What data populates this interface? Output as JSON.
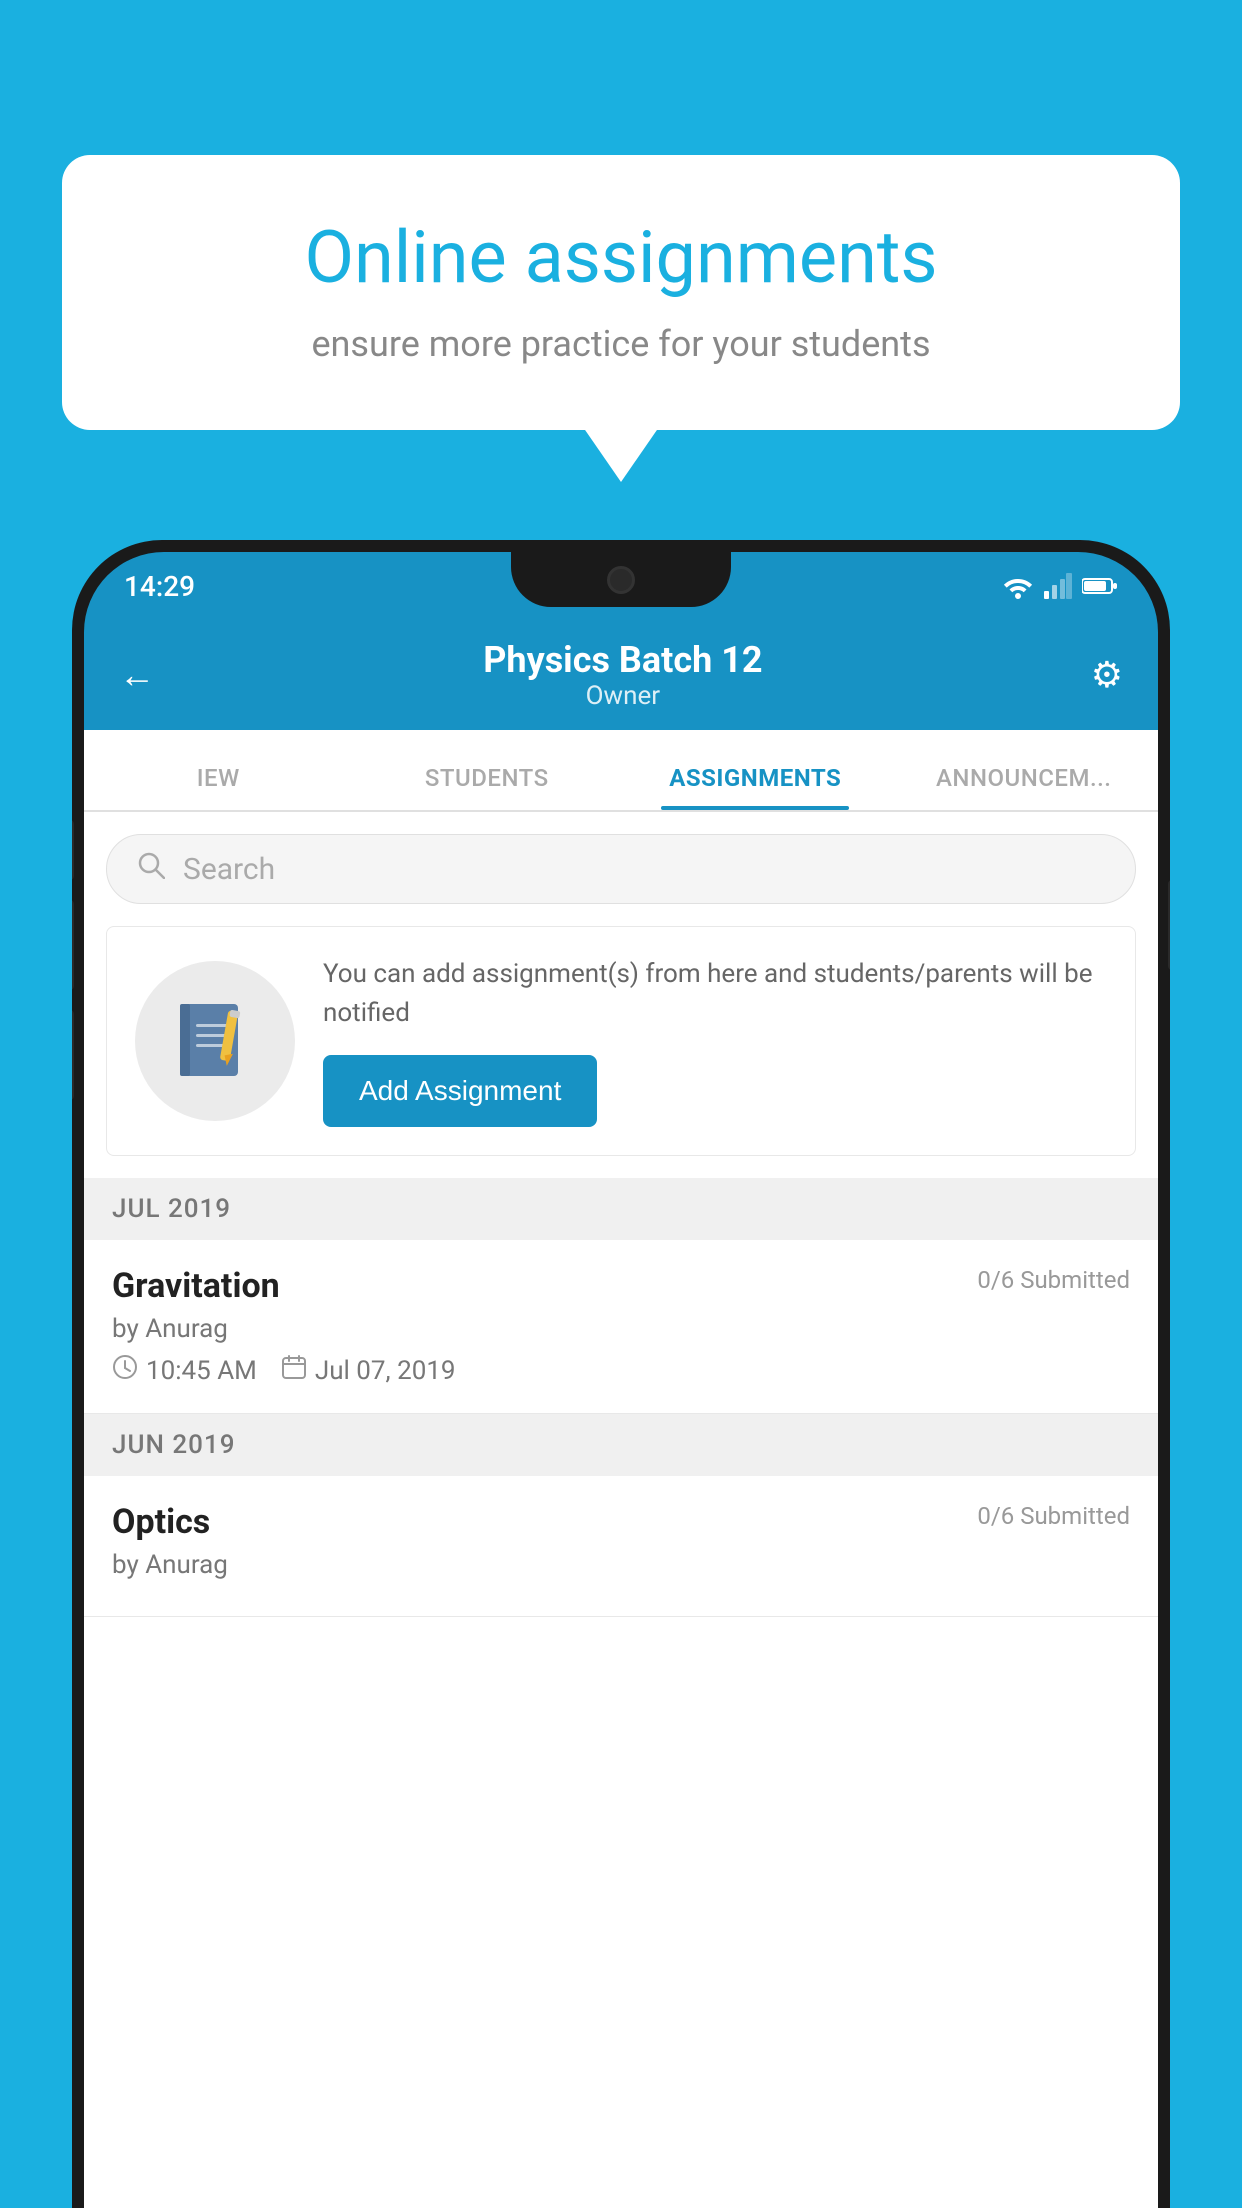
{
  "background_color": "#1ab0e0",
  "speech_bubble": {
    "title": "Online assignments",
    "subtitle": "ensure more practice for your students"
  },
  "phone": {
    "status_bar": {
      "time": "14:29",
      "wifi_icon": "wifi",
      "signal_icon": "signal",
      "battery_icon": "battery"
    },
    "header": {
      "title": "Physics Batch 12",
      "subtitle": "Owner",
      "back_label": "←",
      "settings_label": "⚙"
    },
    "tabs": [
      {
        "label": "IEW",
        "active": false
      },
      {
        "label": "STUDENTS",
        "active": false
      },
      {
        "label": "ASSIGNMENTS",
        "active": true
      },
      {
        "label": "ANNOUNCEM...",
        "active": false
      }
    ],
    "search": {
      "placeholder": "Search"
    },
    "info_card": {
      "text": "You can add assignment(s) from here and students/parents will be notified",
      "button_label": "Add Assignment"
    },
    "sections": [
      {
        "header": "JUL 2019",
        "assignments": [
          {
            "name": "Gravitation",
            "submitted": "0/6 Submitted",
            "by": "by Anurag",
            "time": "10:45 AM",
            "date": "Jul 07, 2019"
          }
        ]
      },
      {
        "header": "JUN 2019",
        "assignments": [
          {
            "name": "Optics",
            "submitted": "0/6 Submitted",
            "by": "by Anurag",
            "time": "",
            "date": ""
          }
        ]
      }
    ]
  }
}
